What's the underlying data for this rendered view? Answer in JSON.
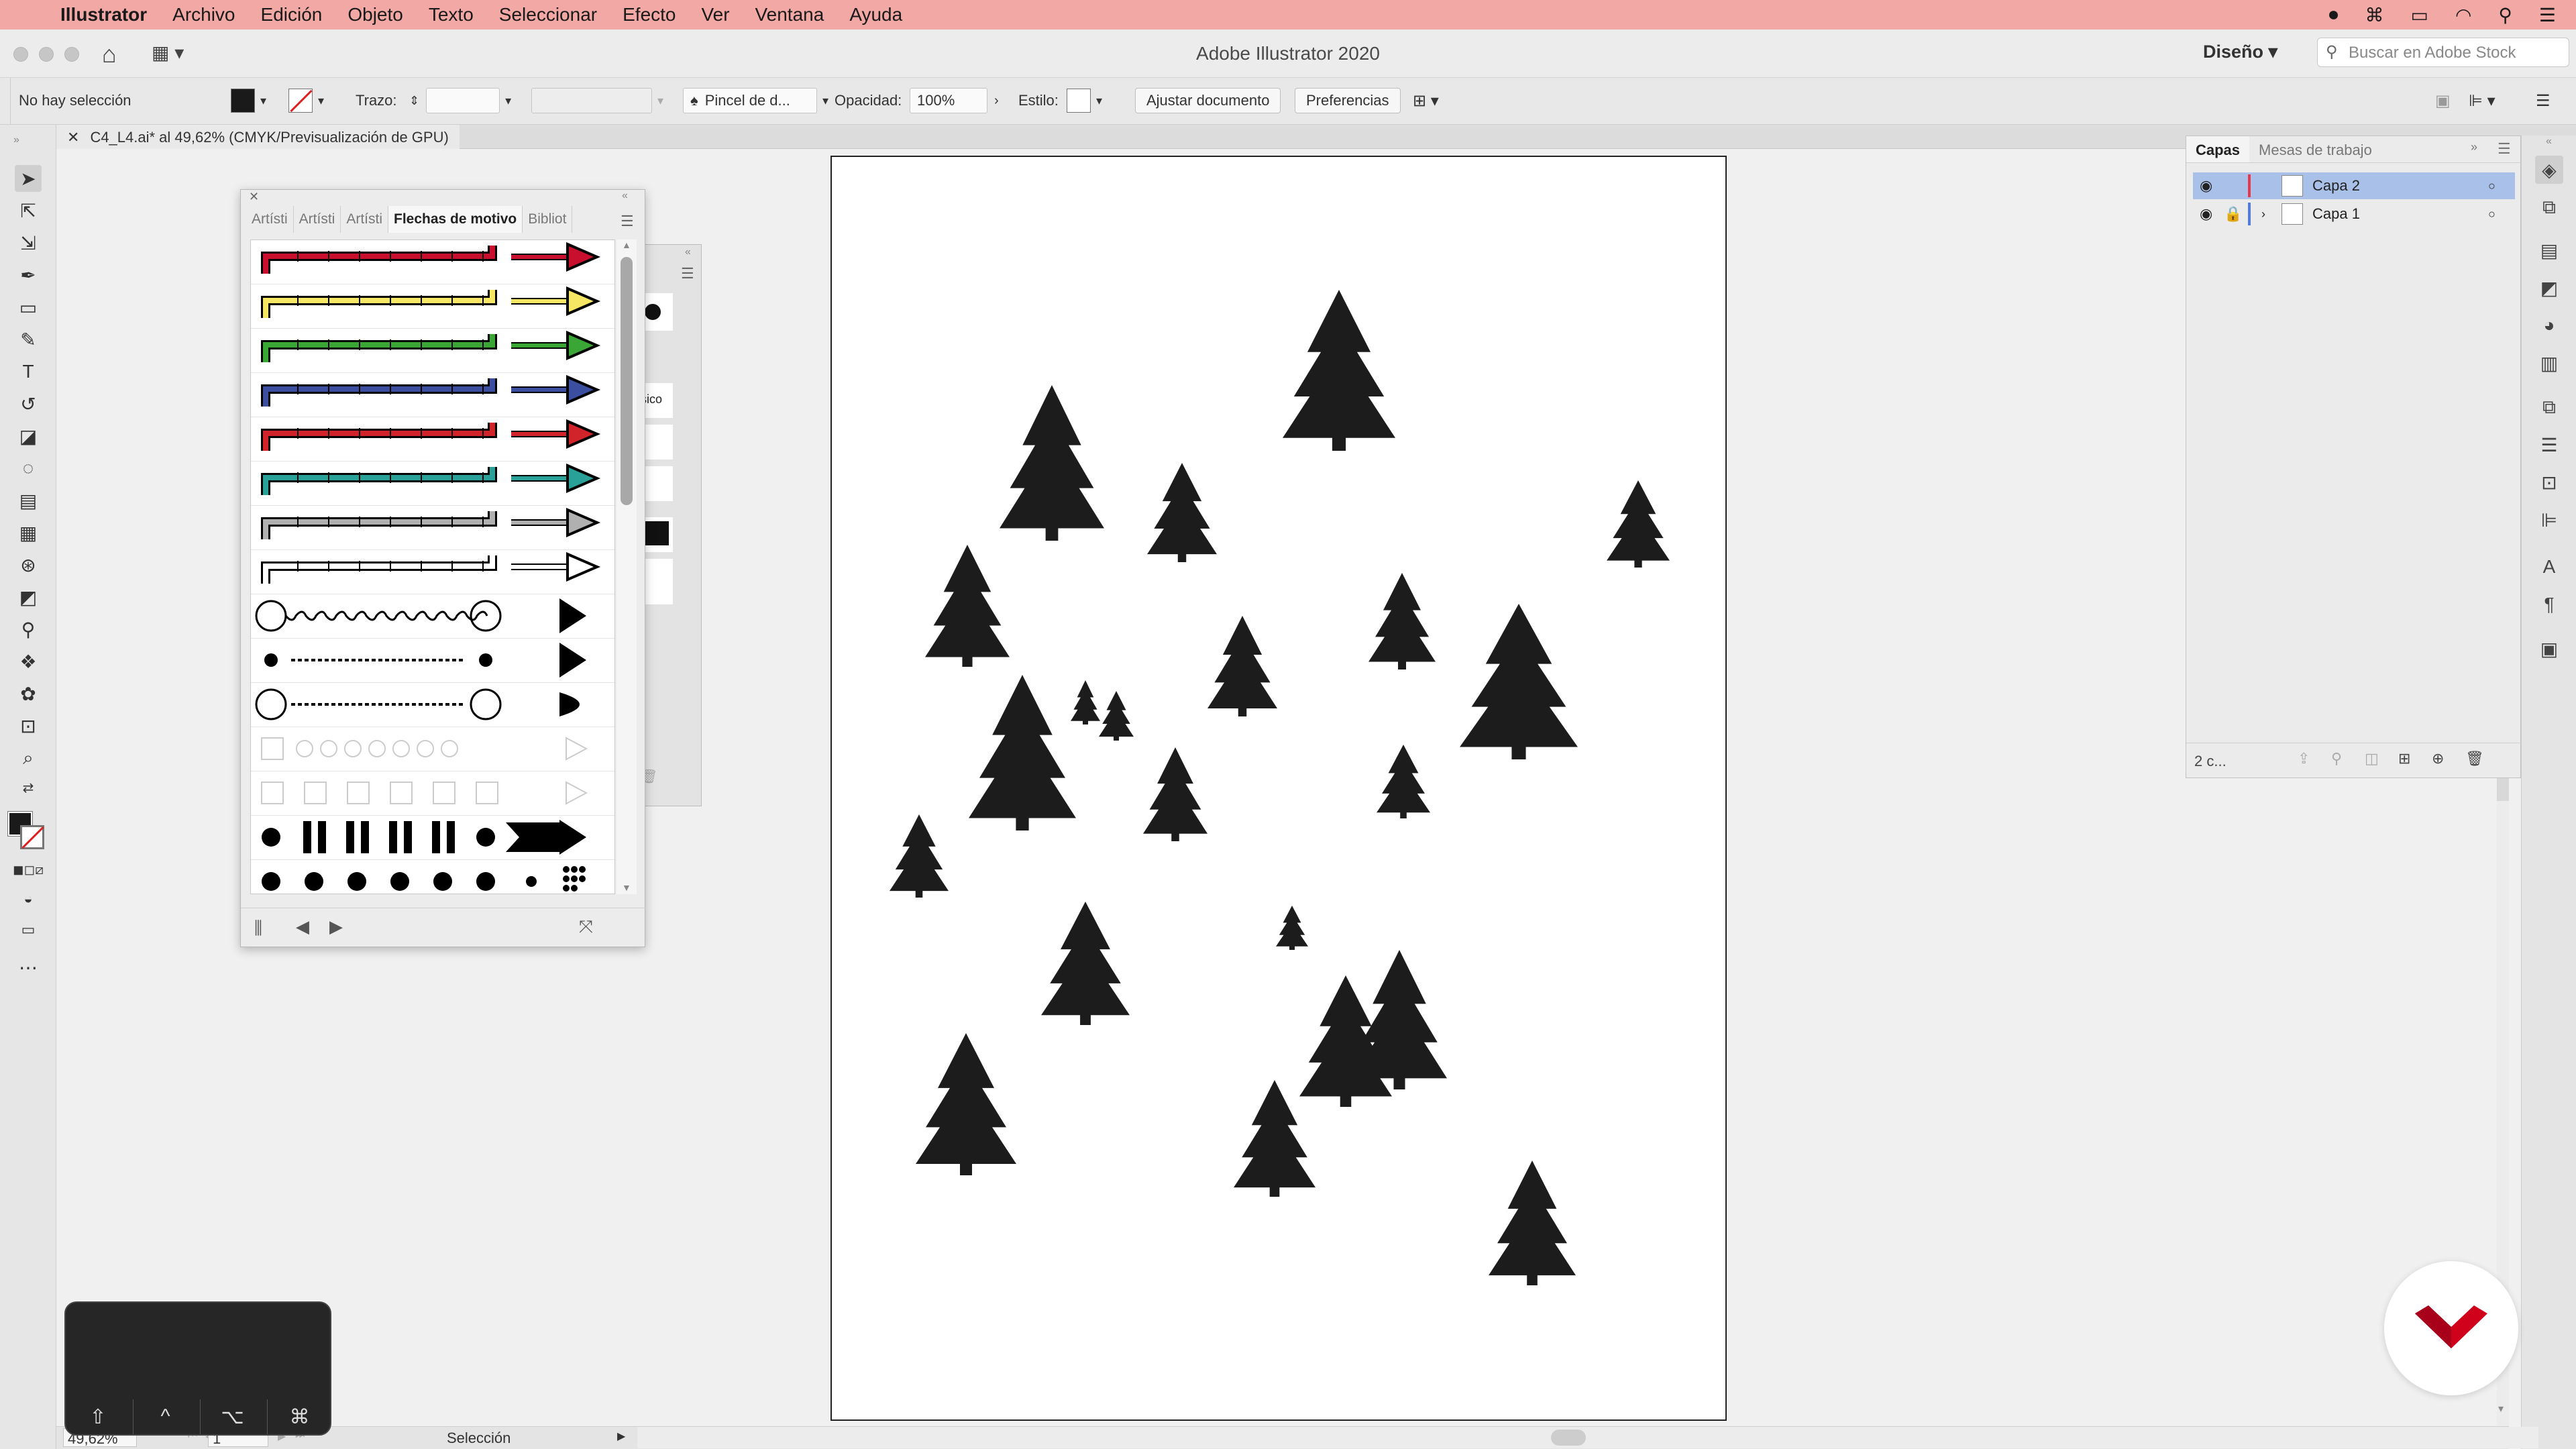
{
  "menubar": {
    "items": [
      "Illustrator",
      "Archivo",
      "Edición",
      "Objeto",
      "Texto",
      "Seleccionar",
      "Efecto",
      "Ver",
      "Ventana",
      "Ayuda"
    ]
  },
  "window": {
    "title": "Adobe Illustrator 2020",
    "workspace": "Diseño",
    "stock_search_placeholder": "Buscar en Adobe Stock"
  },
  "controlbar": {
    "selection": "No hay selección",
    "stroke_label": "Trazo:",
    "brush_name": "Pincel de d...",
    "opacity_label": "Opacidad:",
    "opacity_value": "100%",
    "style_label": "Estilo:",
    "fit_button": "Ajustar documento",
    "prefs_button": "Preferencias"
  },
  "document": {
    "tab_title": "C4_L4.ai* al 49,62% (CMYK/Previsualización de GPU)"
  },
  "brushes_panel": {
    "tabs": [
      "Artísti",
      "Artísti",
      "Artísti",
      "Flechas de motivo",
      "Bibliot"
    ],
    "active_tab": 3,
    "back_panel_text": "sico",
    "rows": [
      {
        "type": "arrow",
        "color": "#c8102e"
      },
      {
        "type": "arrow",
        "color": "#f5e663"
      },
      {
        "type": "arrow",
        "color": "#3aa635"
      },
      {
        "type": "arrow",
        "color": "#3b4ea0"
      },
      {
        "type": "arrow",
        "color": "#d1232a"
      },
      {
        "type": "arrow",
        "color": "#2aa198"
      },
      {
        "type": "arrow",
        "color": "#b0b0b0"
      },
      {
        "type": "arrow",
        "color": "#ffffff"
      },
      {
        "type": "ornament"
      },
      {
        "type": "dots-line"
      },
      {
        "type": "dots-ornament"
      },
      {
        "type": "ghost"
      },
      {
        "type": "ghost-squares"
      },
      {
        "type": "bars"
      },
      {
        "type": "dots"
      }
    ]
  },
  "layers_panel": {
    "tabs": [
      "Capas",
      "Mesas de trabajo"
    ],
    "layers": [
      {
        "name": "Capa 2",
        "color": "#e8364b",
        "selected": true,
        "locked": false
      },
      {
        "name": "Capa 1",
        "color": "#4a7be8",
        "selected": false,
        "locked": true
      }
    ],
    "footer_count": "2 c..."
  },
  "statusbar": {
    "zoom": "49,62%",
    "artboard": "1",
    "tool": "Selección"
  },
  "touchbar": {
    "keys": [
      "⇧",
      "^",
      "⌥",
      "⌘"
    ]
  },
  "colors": {
    "menubar_bg": "#f2a8a4",
    "tree": "#1c1c1c",
    "logo": "#d0021b"
  }
}
